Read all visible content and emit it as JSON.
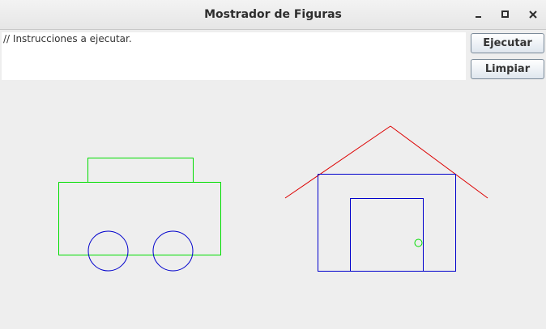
{
  "window": {
    "title": "Mostrador de Figuras"
  },
  "window_controls": {
    "minimize_icon": "minimize-icon",
    "maximize_icon": "maximize-icon",
    "close_icon": "close-icon"
  },
  "editor": {
    "value": "// Instrucciones a ejecutar."
  },
  "buttons": {
    "run_label": "Ejecutar",
    "clear_label": "Limpiar"
  },
  "colors": {
    "green": "#00dd00",
    "blue": "#0000cc",
    "red": "#dd0000",
    "background": "#eeeeee"
  }
}
